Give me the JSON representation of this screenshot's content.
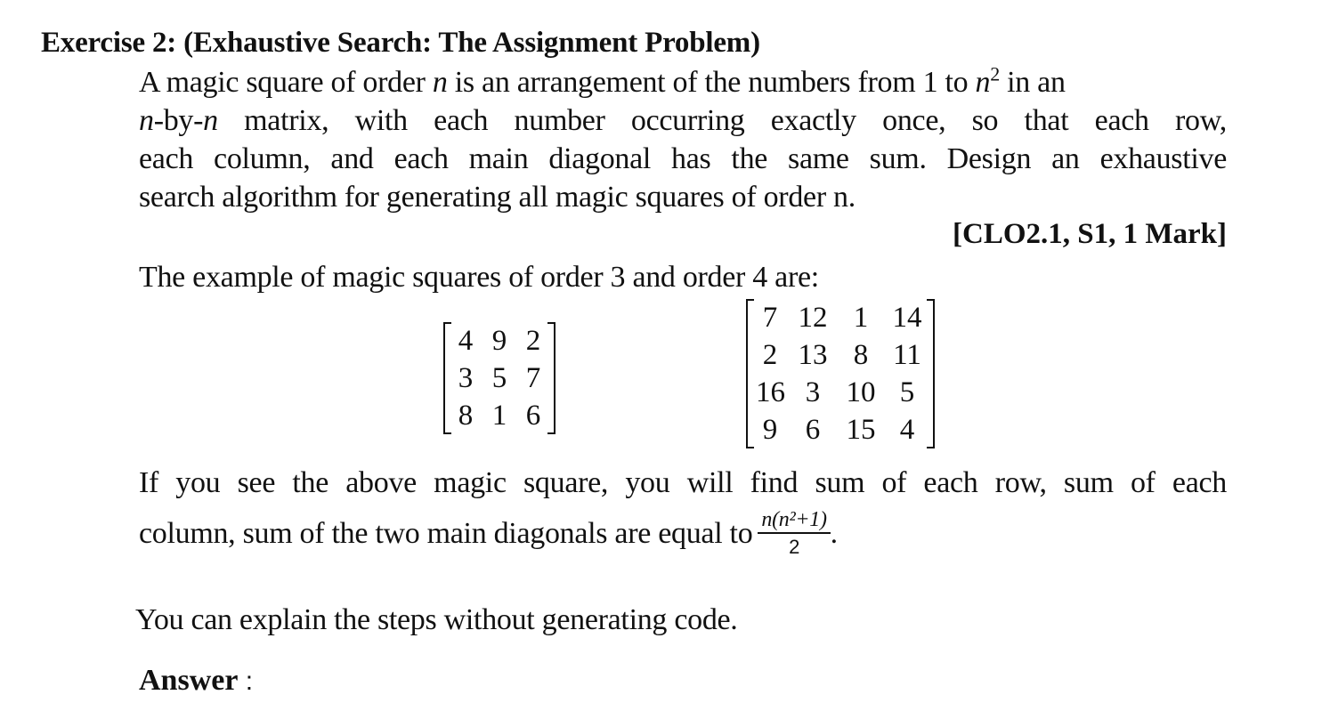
{
  "exercise": {
    "heading": "Exercise 2: (Exhaustive Search: The Assignment Problem)",
    "paragraph_lines": [
      [
        "A magic square of order ",
        "n",
        " is an arrangement of the numbers from 1 to ",
        "n",
        "2",
        " in an"
      ],
      [
        "n",
        "-by-",
        "n",
        " matrix, with each number occurring exactly once, so that each row,"
      ],
      "each column, and each main diagonal has the same sum. Design an exhaustive",
      "search algorithm for generating all magic squares of order n."
    ],
    "reference": "[CLO2.1, S1, 1 Mark]",
    "example_intro": "The example of magic squares of order 3 and order 4 are:",
    "magic_square_3": [
      [
        "4",
        "9",
        "2"
      ],
      [
        "3",
        "5",
        "7"
      ],
      [
        "8",
        "1",
        "6"
      ]
    ],
    "magic_square_4": [
      [
        "7",
        "12",
        "1",
        "14"
      ],
      [
        "2",
        "13",
        "8",
        "11"
      ],
      [
        "16",
        "3",
        "10",
        "5"
      ],
      [
        "9",
        "6",
        "15",
        "4"
      ]
    ],
    "sum_line_1": "If you see the above magic square, you will find sum of each row, sum of each",
    "sum_line_2": "column, sum of the two main diagonals are equal to",
    "formula": {
      "numerator": "n(n²+1)",
      "denominator": "2",
      "trailing": "."
    },
    "instruction": "You can explain the steps without generating code.",
    "answer_label": "Answer",
    "answer_colon": " :"
  }
}
